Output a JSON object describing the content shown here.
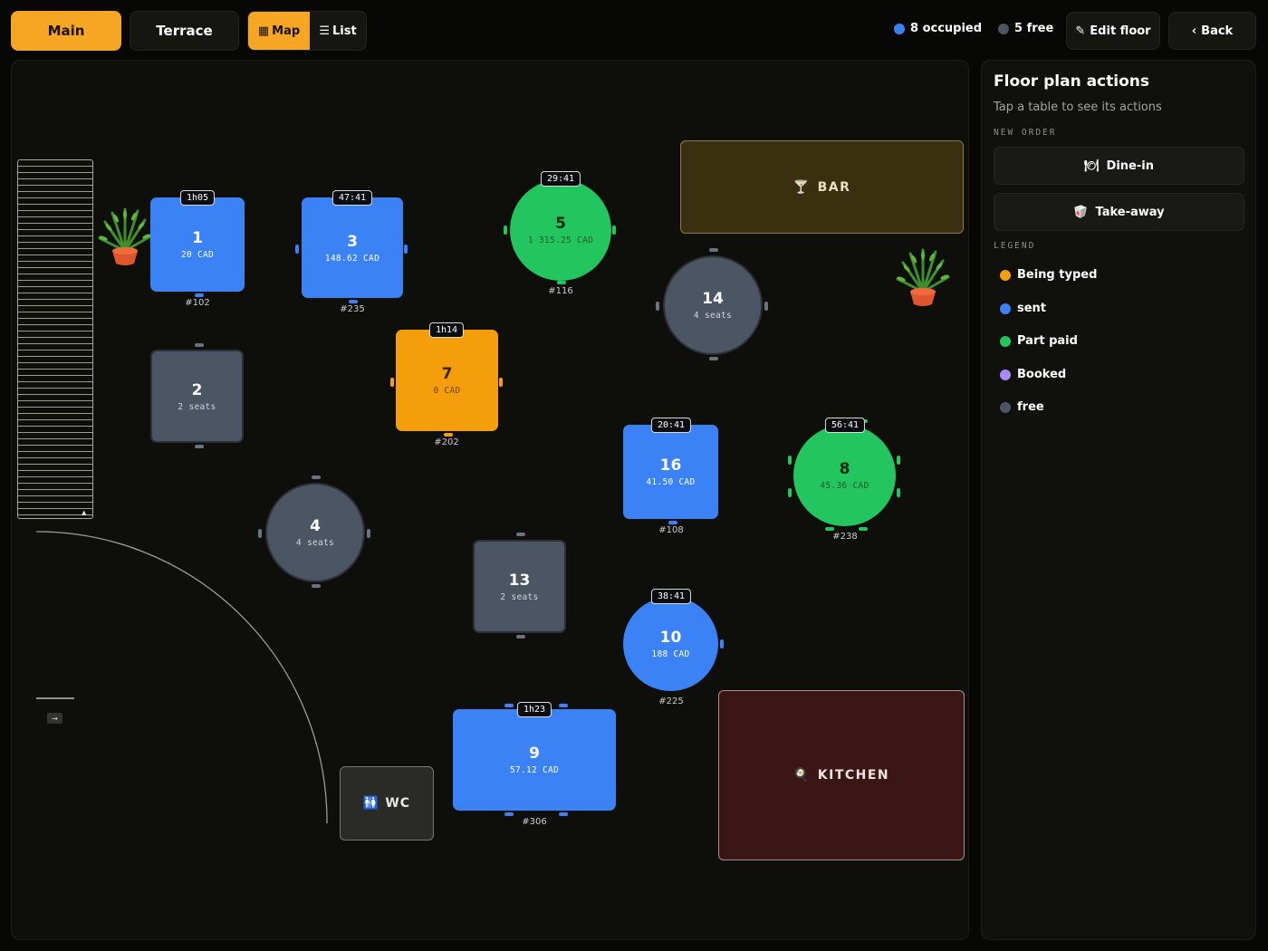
{
  "topbar": {
    "tabs": [
      {
        "label": "Main",
        "active": true
      },
      {
        "label": "Terrace",
        "active": false
      }
    ],
    "view_toggle": {
      "map_label": "Map",
      "list_label": "List",
      "map_icon": "grid-icon",
      "list_icon": "list-icon",
      "active": "map"
    },
    "occupied": "8 occupied",
    "free": "5 free",
    "edit_label": "Edit floor",
    "back_label": "Back"
  },
  "colors": {
    "accent": "#f5a623",
    "sent": "#3b82f6",
    "part_paid": "#22c55e",
    "being_typed": "#f59e0b",
    "booked": "#a78bfa",
    "free": "#4b5563"
  },
  "floor": {
    "bar_label": "BAR",
    "kitchen_label": "KITCHEN",
    "wc_label": "WC",
    "exit_label": "→",
    "stairs_arrow": "▲",
    "tables": [
      {
        "number": "1",
        "info": "20 CAD",
        "timer": "1h05",
        "order": "#102",
        "status": "sent"
      },
      {
        "number": "3",
        "info": "148.62 CAD",
        "timer": "47:41",
        "order": "#235",
        "status": "sent"
      },
      {
        "number": "5",
        "info": "1 315.25 CAD",
        "timer": "29:41",
        "order": "#116",
        "status": "part_paid"
      },
      {
        "number": "14",
        "info": "4 seats",
        "status": "free"
      },
      {
        "number": "2",
        "info": "2 seats",
        "status": "free"
      },
      {
        "number": "7",
        "info": "0 CAD",
        "timer": "1h14",
        "order": "#202",
        "status": "being_typed"
      },
      {
        "number": "16",
        "info": "41.50 CAD",
        "timer": "20:41",
        "order": "#108",
        "status": "sent"
      },
      {
        "number": "8",
        "info": "45.36 CAD",
        "timer": "56:41",
        "order": "#238",
        "status": "part_paid"
      },
      {
        "number": "4",
        "info": "4 seats",
        "status": "free"
      },
      {
        "number": "13",
        "info": "2 seats",
        "status": "free"
      },
      {
        "number": "10",
        "info": "188 CAD",
        "timer": "38:41",
        "order": "#225",
        "status": "sent"
      },
      {
        "number": "9",
        "info": "57.12 CAD",
        "timer": "1h23",
        "order": "#306",
        "status": "sent"
      }
    ]
  },
  "panel": {
    "title": "Floor plan actions",
    "subtitle": "Tap a table to see its actions",
    "new_order_label": "NEW ORDER",
    "dine_in_label": "Dine-in",
    "take_away_label": "Take-away",
    "legend_label": "LEGEND",
    "legend": [
      {
        "label": "Being typed",
        "color": "#f59e0b"
      },
      {
        "label": "sent",
        "color": "#3b82f6"
      },
      {
        "label": "Part paid",
        "color": "#22c55e"
      },
      {
        "label": "Booked",
        "color": "#a78bfa"
      },
      {
        "label": "free",
        "color": "#4b5563"
      }
    ]
  }
}
